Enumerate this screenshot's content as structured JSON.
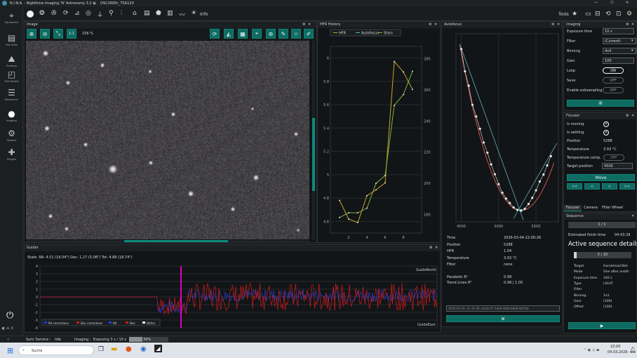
{
  "titlebar": {
    "app": "N.I.N.A. - Nighttime Imaging 'N' Astronomy 3.2",
    "profile": "DSC2600c_TSA120",
    "tools": "Tools"
  },
  "toolbar": {
    "info": "Info"
  },
  "nav": [
    {
      "label": "Equipment",
      "icon": "telescope-icon"
    },
    {
      "label": "Sky Atlas",
      "icon": "atlas-icon"
    },
    {
      "label": "Framing",
      "icon": "framing-icon"
    },
    {
      "label": "Flat Wizard",
      "icon": "flat-wizard-icon"
    },
    {
      "label": "Sequencer",
      "icon": "sequencer-icon"
    },
    {
      "label": "Imaging",
      "icon": "imaging-icon"
    },
    {
      "label": "Options",
      "icon": "gear-icon"
    },
    {
      "label": "Plugins",
      "icon": "puzzle-icon"
    }
  ],
  "image_panel": {
    "title": "Image",
    "zoom_1to1": "1:1",
    "zoom_pct": "156 %"
  },
  "hfr_history": {
    "title": "HFR History",
    "legend": [
      "HFR",
      "Autofocus",
      "Stars"
    ]
  },
  "autofocus": {
    "title": "Autofocus",
    "details": [
      [
        "Time",
        "2026-03-04 22:00:26"
      ],
      [
        "Position",
        "5288"
      ],
      [
        "HFR",
        "1.04"
      ],
      [
        "Temperature",
        "3.93 °C"
      ],
      [
        "Filter",
        "none"
      ]
    ],
    "fit": [
      [
        "Parabolic R²",
        "0.99"
      ],
      [
        "Trend Lines R²",
        "0.98 | 1.00"
      ]
    ],
    "run_select": "2026-03-04--21-33-38--a2d2c57-5eb8-4904-b8b8-0bf7ab"
  },
  "imaging": {
    "title": "Imaging",
    "rows": [
      [
        "Exposure time",
        "10 s"
      ],
      [
        "Filter",
        "(Current)"
      ],
      [
        "Binning",
        "4x4"
      ],
      [
        "Gain",
        "100"
      ],
      [
        "Loop",
        "ON"
      ],
      [
        "Save",
        "OFF"
      ],
      [
        "Enable subsampling",
        "OFF"
      ]
    ]
  },
  "focuser": {
    "title": "Focuser",
    "rows": [
      [
        "Is moving",
        ""
      ],
      [
        "Is settling",
        ""
      ],
      [
        "Position",
        "5288"
      ],
      [
        "Temperature",
        "3.93 °C"
      ],
      [
        "Temperature comp.",
        "OFF"
      ],
      [
        "Target position",
        "4500"
      ]
    ],
    "move": "Move",
    "steps": [
      "<<",
      "<",
      ">",
      ">>"
    ],
    "tabs": [
      "Focuser",
      "Camera",
      "Filter Wheel"
    ]
  },
  "sequence": {
    "title": "Sequence",
    "progress": "1 / 1",
    "finish_label": "Estimated finish time",
    "finish_time": "04:43:29",
    "active_title": "Active sequence details",
    "exposure_count": "5 / 20",
    "details": [
      [
        "Target",
        "Horsehead Net"
      ],
      [
        "Mode",
        "One after anoth"
      ],
      [
        "Exposure time",
        "240 s"
      ],
      [
        "Type",
        "LIGHT"
      ],
      [
        "Filter",
        ""
      ],
      [
        "Binning",
        "1x1"
      ],
      [
        "Gain",
        "(100)"
      ],
      [
        "Offset",
        "(100)"
      ]
    ]
  },
  "guider": {
    "title": "Guider",
    "state": "State:  RA: 4.51 (18.04\")  Dec: 1.27 (5.08\")  Tot: 4.68 (18.74\")",
    "north": "GuideNorth",
    "east": "GuideEast",
    "y_ticks": [
      "4",
      "3",
      "2",
      "1",
      "0",
      "-1",
      "-2",
      "-3",
      "-4"
    ],
    "legend": [
      "RA corrections",
      "Dec corrections",
      "RA",
      "Dec",
      "Dither"
    ]
  },
  "statusbar": {
    "service": "Sync Service :",
    "service_state": "Idle",
    "imaging": "Imaging :",
    "imaging_state": "Exposing 3 s / 10 s",
    "progress": "34%"
  },
  "taskbar": {
    "search": "Suche",
    "time": "22:00",
    "date": "04.03.2026"
  },
  "colors": {
    "accent": "#0e6b62",
    "hfr": "#c9a227",
    "stars": "#7cb342",
    "fit": "#e05a50",
    "ra": "#1f3fd8",
    "dec": "#d01a1a"
  },
  "chart_data": [
    {
      "type": "line",
      "title": "HFR History",
      "x": [
        1,
        2,
        3,
        4,
        5,
        6,
        7,
        8,
        9
      ],
      "series": [
        {
          "name": "HFR",
          "values": [
            4.78,
            4.62,
            4.59,
            4.82,
            4.87,
            4.93,
            5.97,
            5.88,
            5.73
          ]
        },
        {
          "name": "Stars",
          "values": [
            178,
            181,
            181,
            184,
            200,
            205,
            250,
            257,
            272
          ]
        }
      ],
      "xlim": [
        0,
        10
      ],
      "ylim": [
        4.5,
        6.1
      ],
      "y2lim": [
        168,
        288
      ],
      "yticks": [
        4.6,
        4.8,
        5,
        5.2,
        5.4,
        5.6,
        5.8,
        6
      ],
      "y2ticks": [
        180,
        200,
        220,
        240,
        260,
        280
      ],
      "xticks": [
        2,
        4,
        6,
        8
      ]
    },
    {
      "type": "scatter",
      "title": "Autofocus",
      "x": [
        4500,
        4550,
        4600,
        4650,
        4700,
        4750,
        4800,
        4850,
        4900,
        4950,
        5000,
        5050,
        5100,
        5150,
        5200,
        5250,
        5300,
        5350,
        5400,
        5450,
        5500,
        5550,
        5600,
        5650,
        5700
      ],
      "values": [
        5.75,
        5.1,
        4.68,
        4.12,
        3.78,
        3.42,
        3.02,
        2.72,
        2.38,
        2.09,
        1.8,
        1.55,
        1.38,
        1.25,
        1.12,
        1.05,
        1.03,
        1.08,
        1.22,
        1.4,
        1.62,
        1.88,
        2.08,
        2.35,
        2.62
      ],
      "xlim": [
        4430,
        5800
      ],
      "ylim": [
        0.7,
        6.2
      ],
      "xticks": [
        4500,
        5000,
        5500
      ]
    }
  ]
}
